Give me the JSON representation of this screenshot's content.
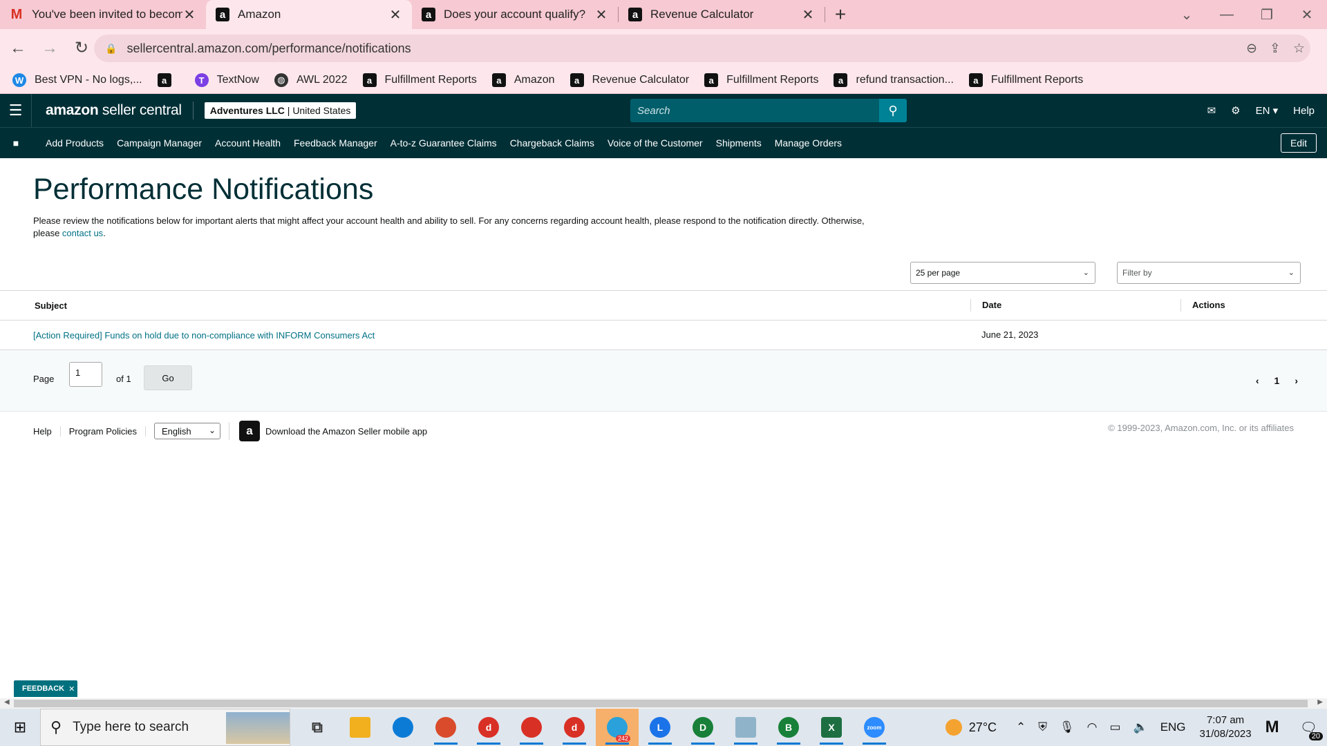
{
  "browser": {
    "tabs": [
      {
        "title": "You've been invited to become a",
        "favicon": "gmail-icon",
        "active": false
      },
      {
        "title": "Amazon",
        "favicon": "amazon-icon",
        "active": true
      },
      {
        "title": "Does your account qualify?",
        "favicon": "amazon-icon",
        "active": false
      },
      {
        "title": "Revenue Calculator",
        "favicon": "amazon-icon",
        "active": false
      }
    ],
    "url": "sellercentral.amazon.com/performance/notifications",
    "bookmarks": [
      {
        "label": "Best VPN - No logs,...",
        "icon": "vpn-icon"
      },
      {
        "label": "",
        "icon": "amazon-icon"
      },
      {
        "label": "TextNow",
        "icon": "textnow-icon"
      },
      {
        "label": "AWL 2022",
        "icon": "globe-icon"
      },
      {
        "label": "Fulfillment Reports",
        "icon": "amazon-icon"
      },
      {
        "label": "Amazon",
        "icon": "amazon-icon"
      },
      {
        "label": "Revenue Calculator",
        "icon": "amazon-icon"
      },
      {
        "label": "Fulfillment Reports",
        "icon": "amazon-icon"
      },
      {
        "label": "refund transaction...",
        "icon": "amazon-icon"
      },
      {
        "label": "Fulfillment Reports",
        "icon": "amazon-icon"
      }
    ],
    "colors": {
      "tab_bg": "#f7c9d2",
      "toolbar_bg": "#fde7ec"
    }
  },
  "seller_central": {
    "logo": "amazon seller central",
    "logo_brand": "amazon",
    "logo_rest": " seller central",
    "account_name": "Adventures LLC",
    "account_region": " | United States",
    "search_placeholder": "Search",
    "language": "EN",
    "help": "Help",
    "nav_items": [
      "Add Products",
      "Campaign Manager",
      "Account Health",
      "Feedback Manager",
      "A-to-z Guarantee Claims",
      "Chargeback Claims",
      "Voice of the Customer",
      "Shipments",
      "Manage Orders"
    ],
    "edit_label": "Edit",
    "colors": {
      "header_bg": "#002f36",
      "search_bg": "#005e6b",
      "search_btn": "#008296",
      "link": "#007185"
    }
  },
  "page": {
    "title": "Performance Notifications",
    "intro_text": "Please review the notifications below for important alerts that might affect your account health and ability to sell. For any concerns regarding account health, please respond to the notification directly. Otherwise, please ",
    "contact_link": "contact us",
    "intro_end": ".",
    "per_page": "25 per page",
    "filter_placeholder": "Filter by",
    "table": {
      "columns": [
        "Subject",
        "Date",
        "Actions"
      ],
      "rows": [
        {
          "subject": "[Action Required] Funds on hold due to non-compliance with INFORM Consumers Act",
          "date": "June 21, 2023",
          "actions": ""
        }
      ]
    },
    "pager": {
      "page_label": "Page",
      "page_value": "1",
      "of_label": "of 1",
      "go_label": "Go",
      "current": "1"
    }
  },
  "footer": {
    "help": "Help",
    "program_policies": "Program Policies",
    "language": "English",
    "app_link": "Download the Amazon Seller mobile app",
    "copyright": "© 1999-2023, Amazon.com, Inc. or its affiliates"
  },
  "feedback_label": "FEEDBACK",
  "taskbar": {
    "search_placeholder": "Type here to search",
    "weather": "27°C",
    "language": "ENG",
    "time": "7:07 am",
    "date": "31/08/2023",
    "telegram_badge": "242",
    "notification_count": "20",
    "apps": [
      {
        "name": "task-view-icon",
        "color": "#333333",
        "label": ""
      },
      {
        "name": "file-explorer-icon",
        "color": "#f2b01e",
        "label": ""
      },
      {
        "name": "edge-icon",
        "color": "#0c7bd6",
        "label": ""
      },
      {
        "name": "snip-icon",
        "color": "#d94b2b",
        "label": ""
      },
      {
        "name": "chrome-profile-icon",
        "color": "#d93025",
        "label": "d"
      },
      {
        "name": "chrome-profile-icon",
        "color": "#d93025",
        "label": ""
      },
      {
        "name": "chrome-profile-icon",
        "color": "#d93025",
        "label": "d"
      },
      {
        "name": "telegram-icon",
        "color": "#2aa1da",
        "label": ""
      },
      {
        "name": "chrome-profile-icon",
        "color": "#1a73e8",
        "label": "L"
      },
      {
        "name": "chrome-profile-icon",
        "color": "#188038",
        "label": "D"
      },
      {
        "name": "notepad-icon",
        "color": "#8fb4c9",
        "label": ""
      },
      {
        "name": "chrome-profile-icon",
        "color": "#188038",
        "label": "B"
      },
      {
        "name": "excel-icon",
        "color": "#1d6f42",
        "label": "X"
      },
      {
        "name": "zoom-icon",
        "color": "#2d8cff",
        "label": "zoom"
      }
    ]
  }
}
